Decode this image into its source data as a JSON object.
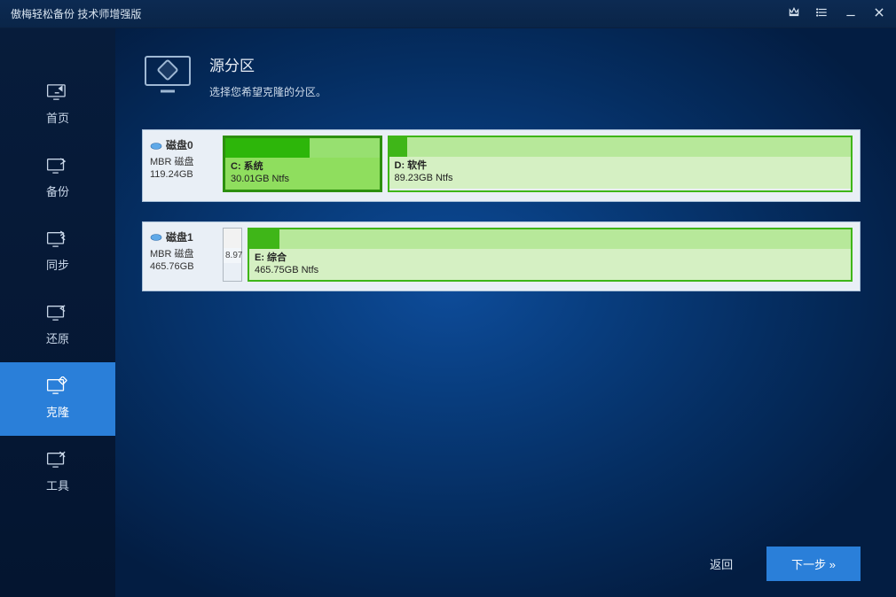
{
  "titlebar": {
    "title": "傲梅轻松备份 技术师增强版"
  },
  "sidebar": {
    "items": [
      {
        "label": "首页"
      },
      {
        "label": "备份"
      },
      {
        "label": "同步"
      },
      {
        "label": "还原"
      },
      {
        "label": "克隆"
      },
      {
        "label": "工具"
      }
    ]
  },
  "header": {
    "title": "源分区",
    "subtitle": "选择您希望克隆的分区。"
  },
  "disks": [
    {
      "name": "磁盘0",
      "type": "MBR 磁盘",
      "size": "119.24GB",
      "partitions": [
        {
          "name": "C: 系统",
          "detail": "30.01GB Ntfs",
          "width_pct": 25,
          "used_pct": 55,
          "selected": true
        },
        {
          "name": "D: 软件",
          "detail": "89.23GB Ntfs",
          "width_pct": 75,
          "used_pct": 4,
          "selected": false
        }
      ]
    },
    {
      "name": "磁盘1",
      "type": "MBR 磁盘",
      "size": "465.76GB",
      "small_partition": {
        "label": "8.97"
      },
      "partitions": [
        {
          "name": "E: 综合",
          "detail": "465.75GB Ntfs",
          "width_pct": 100,
          "used_pct": 5,
          "selected": false
        }
      ]
    }
  ],
  "footer": {
    "back": "返回",
    "next": "下一步 »"
  }
}
